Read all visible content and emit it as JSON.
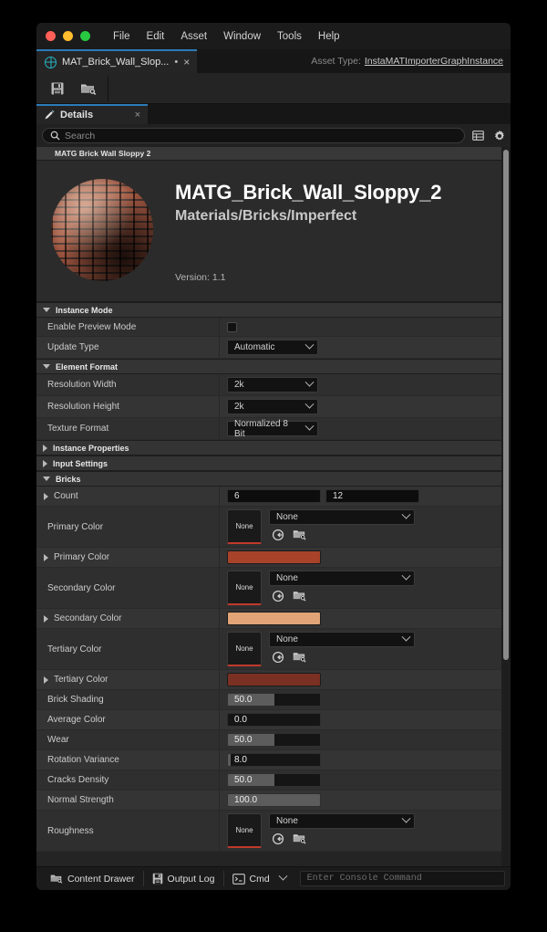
{
  "window": {
    "menu_items": [
      "File",
      "Edit",
      "Asset",
      "Window",
      "Tools",
      "Help"
    ]
  },
  "asset_tab": {
    "title": "MAT_Brick_Wall_Slop...",
    "dirty_marker": "•",
    "close_glyph": "×",
    "icon": "globe-icon",
    "asset_type_label": "Asset Type:",
    "asset_type_value": "InstaMATImporterGraphInstance"
  },
  "toolbar": {
    "buttons": [
      {
        "name": "save-button",
        "icon": "floppy-disk-icon"
      },
      {
        "name": "browse-button",
        "icon": "folder-search-icon"
      }
    ]
  },
  "details_tab": {
    "label": "Details",
    "icon": "pencil-icon",
    "close_glyph": "×"
  },
  "search": {
    "placeholder": "Search",
    "value": "",
    "icon": "search-icon",
    "right_icons": [
      "grid-view-icon",
      "gear-icon"
    ]
  },
  "hero": {
    "category_header": "MATG Brick Wall Sloppy 2",
    "title": "MATG_Brick_Wall_Sloppy_2",
    "path": "Materials/Bricks/Imperfect",
    "version": "Version: 1.1",
    "thumbnail": "brick-wall-sphere-thumbnail"
  },
  "sections": [
    {
      "name": "instance-mode",
      "label": "Instance Mode",
      "expanded": true,
      "rows": [
        {
          "name": "enable-preview-mode",
          "label": "Enable Preview Mode",
          "type": "checkbox",
          "checked": false
        },
        {
          "name": "update-type",
          "label": "Update Type",
          "type": "dropdown",
          "value": "Automatic"
        }
      ]
    },
    {
      "name": "element-format",
      "label": "Element Format",
      "expanded": true,
      "rows": [
        {
          "name": "resolution-width",
          "label": "Resolution Width",
          "type": "dropdown",
          "value": "2k"
        },
        {
          "name": "resolution-height",
          "label": "Resolution Height",
          "type": "dropdown",
          "value": "2k"
        },
        {
          "name": "texture-format",
          "label": "Texture Format",
          "type": "dropdown",
          "value": "Normalized 8 Bit"
        }
      ]
    },
    {
      "name": "instance-properties",
      "label": "Instance Properties",
      "expanded": false,
      "rows": []
    },
    {
      "name": "input-settings",
      "label": "Input Settings",
      "expanded": false,
      "rows": []
    },
    {
      "name": "bricks",
      "label": "Bricks",
      "expanded": true,
      "rows": [
        {
          "name": "count",
          "label": "Count",
          "type": "vector2",
          "expandable": true,
          "value_x": "6",
          "value_y": "12"
        },
        {
          "name": "primary-color-texture",
          "label": "Primary Color",
          "type": "asset-picker",
          "thumb_label": "None",
          "value": "None"
        },
        {
          "name": "primary-color",
          "label": "Primary Color",
          "type": "color",
          "expandable": true,
          "color": "#a8432a"
        },
        {
          "name": "secondary-color-texture",
          "label": "Secondary Color",
          "type": "asset-picker",
          "thumb_label": "None",
          "value": "None"
        },
        {
          "name": "secondary-color",
          "label": "Secondary Color",
          "type": "color",
          "expandable": true,
          "color": "#e0a476"
        },
        {
          "name": "tertiary-color-texture",
          "label": "Tertiary Color",
          "type": "asset-picker",
          "thumb_label": "None",
          "value": "None"
        },
        {
          "name": "tertiary-color",
          "label": "Tertiary Color",
          "type": "color",
          "expandable": true,
          "color": "#7a3022"
        },
        {
          "name": "brick-shading",
          "label": "Brick Shading",
          "type": "slider",
          "value": "50.0",
          "fill_pct": 50
        },
        {
          "name": "average-color",
          "label": "Average Color",
          "type": "slider",
          "value": "0.0",
          "fill_pct": 0
        },
        {
          "name": "wear",
          "label": "Wear",
          "type": "slider",
          "value": "50.0",
          "fill_pct": 50
        },
        {
          "name": "rotation-variance",
          "label": "Rotation Variance",
          "type": "slider",
          "value": "8.0",
          "fill_pct": 3
        },
        {
          "name": "cracks-density",
          "label": "Cracks Density",
          "type": "slider",
          "value": "50.0",
          "fill_pct": 50
        },
        {
          "name": "normal-strength",
          "label": "Normal Strength",
          "type": "slider",
          "value": "100.0",
          "fill_pct": 100
        },
        {
          "name": "roughness",
          "label": "Roughness",
          "type": "asset-picker",
          "thumb_label": "None",
          "value": "None"
        }
      ]
    }
  ],
  "statusbar": {
    "content_drawer": "Content Drawer",
    "output_log": "Output Log",
    "cmd": "Cmd",
    "console_placeholder": "Enter Console Command"
  },
  "colors": {
    "accent_tab": "#2b7bb9",
    "tab_icon": "#27b3c4",
    "reset_underline": "#c0392b"
  }
}
